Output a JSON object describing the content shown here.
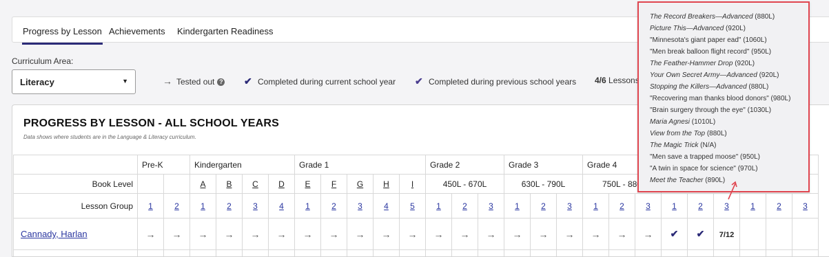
{
  "tabs": [
    {
      "label": "Progress by Lesson",
      "active": true
    },
    {
      "label": "Achievements",
      "active": false
    },
    {
      "label": "Kindergarten Readiness",
      "active": false
    }
  ],
  "curriculum": {
    "label": "Curriculum Area:",
    "value": "Literacy"
  },
  "legend": {
    "tested_out": "Tested out",
    "current_year": "Completed during current school year",
    "previous_years": "Completed during previous school years",
    "count": "4/6",
    "count_label": "Lessons"
  },
  "panel": {
    "title": "PROGRESS BY LESSON - ALL SCHOOL YEARS",
    "subtitle": "Data shows where students are in the Language & Literacy curriculum."
  },
  "grid": {
    "grades": [
      "Pre-K",
      "Kindergarten",
      "Grade 1",
      "Grade 2",
      "Grade 3",
      "Grade 4"
    ],
    "book_level_label": "Book Level",
    "book_levels": [
      "A",
      "B",
      "C",
      "D",
      "E",
      "F",
      "G",
      "H",
      "I"
    ],
    "lexile_ranges": [
      "450L - 670L",
      "630L - 790L",
      "750L - 880"
    ],
    "lesson_group_label": "Lesson Group",
    "lesson_groups": [
      "1",
      "2",
      "1",
      "2",
      "3",
      "4",
      "1",
      "2",
      "3",
      "4",
      "5",
      "1",
      "2",
      "3",
      "1",
      "2",
      "3",
      "1",
      "2",
      "3",
      "1",
      "2",
      "3",
      "1",
      "2",
      "3"
    ],
    "student": {
      "name": "Cannady, Harlan",
      "progress": [
        "→",
        "→",
        "→",
        "→",
        "→",
        "→",
        "→",
        "→",
        "→",
        "→",
        "→",
        "→",
        "→",
        "→",
        "→",
        "→",
        "→",
        "→",
        "→",
        "→",
        "✔",
        "✔",
        "7/12",
        "",
        "",
        ""
      ]
    }
  },
  "tooltip": {
    "items": [
      {
        "text": "The Record Breakers—Advanced",
        "level": "(880L)",
        "italic": true
      },
      {
        "text": "Picture This—Advanced",
        "level": "(920L)",
        "italic": true
      },
      {
        "text": "\"Minnesota's giant paper ead\"",
        "level": "(1060L)",
        "italic": false
      },
      {
        "text": "\"Men break balloon flight record\"",
        "level": "(950L)",
        "italic": false
      },
      {
        "text": "The Feather-Hammer Drop",
        "level": "(920L)",
        "italic": true
      },
      {
        "text": "Your Own Secret Army—Advanced",
        "level": "(920L)",
        "italic": true
      },
      {
        "text": "Stopping the Killers—Advanced",
        "level": "(880L)",
        "italic": true
      },
      {
        "text": "\"Recovering man thanks blood donors\"",
        "level": "(980L)",
        "italic": false
      },
      {
        "text": "\"Brain surgery through the eye\"",
        "level": "(1030L)",
        "italic": false
      },
      {
        "text": "Maria Agnesi",
        "level": "(1010L)",
        "italic": true
      },
      {
        "text": "View from the Top",
        "level": "(880L)",
        "italic": true
      },
      {
        "text": "The Magic Trick",
        "level": "(N/A)",
        "italic": true
      },
      {
        "text": "\"Men save a trapped moose\"",
        "level": "(950L)",
        "italic": false
      },
      {
        "text": "\"A twin in space for science\"",
        "level": "(970L)",
        "italic": false
      },
      {
        "text": "Meet the Teacher",
        "level": "(890L)",
        "italic": true
      }
    ]
  },
  "colors": {
    "accent": "#2b2a77",
    "link": "#2a36a0",
    "highlight": "#e0454f"
  }
}
